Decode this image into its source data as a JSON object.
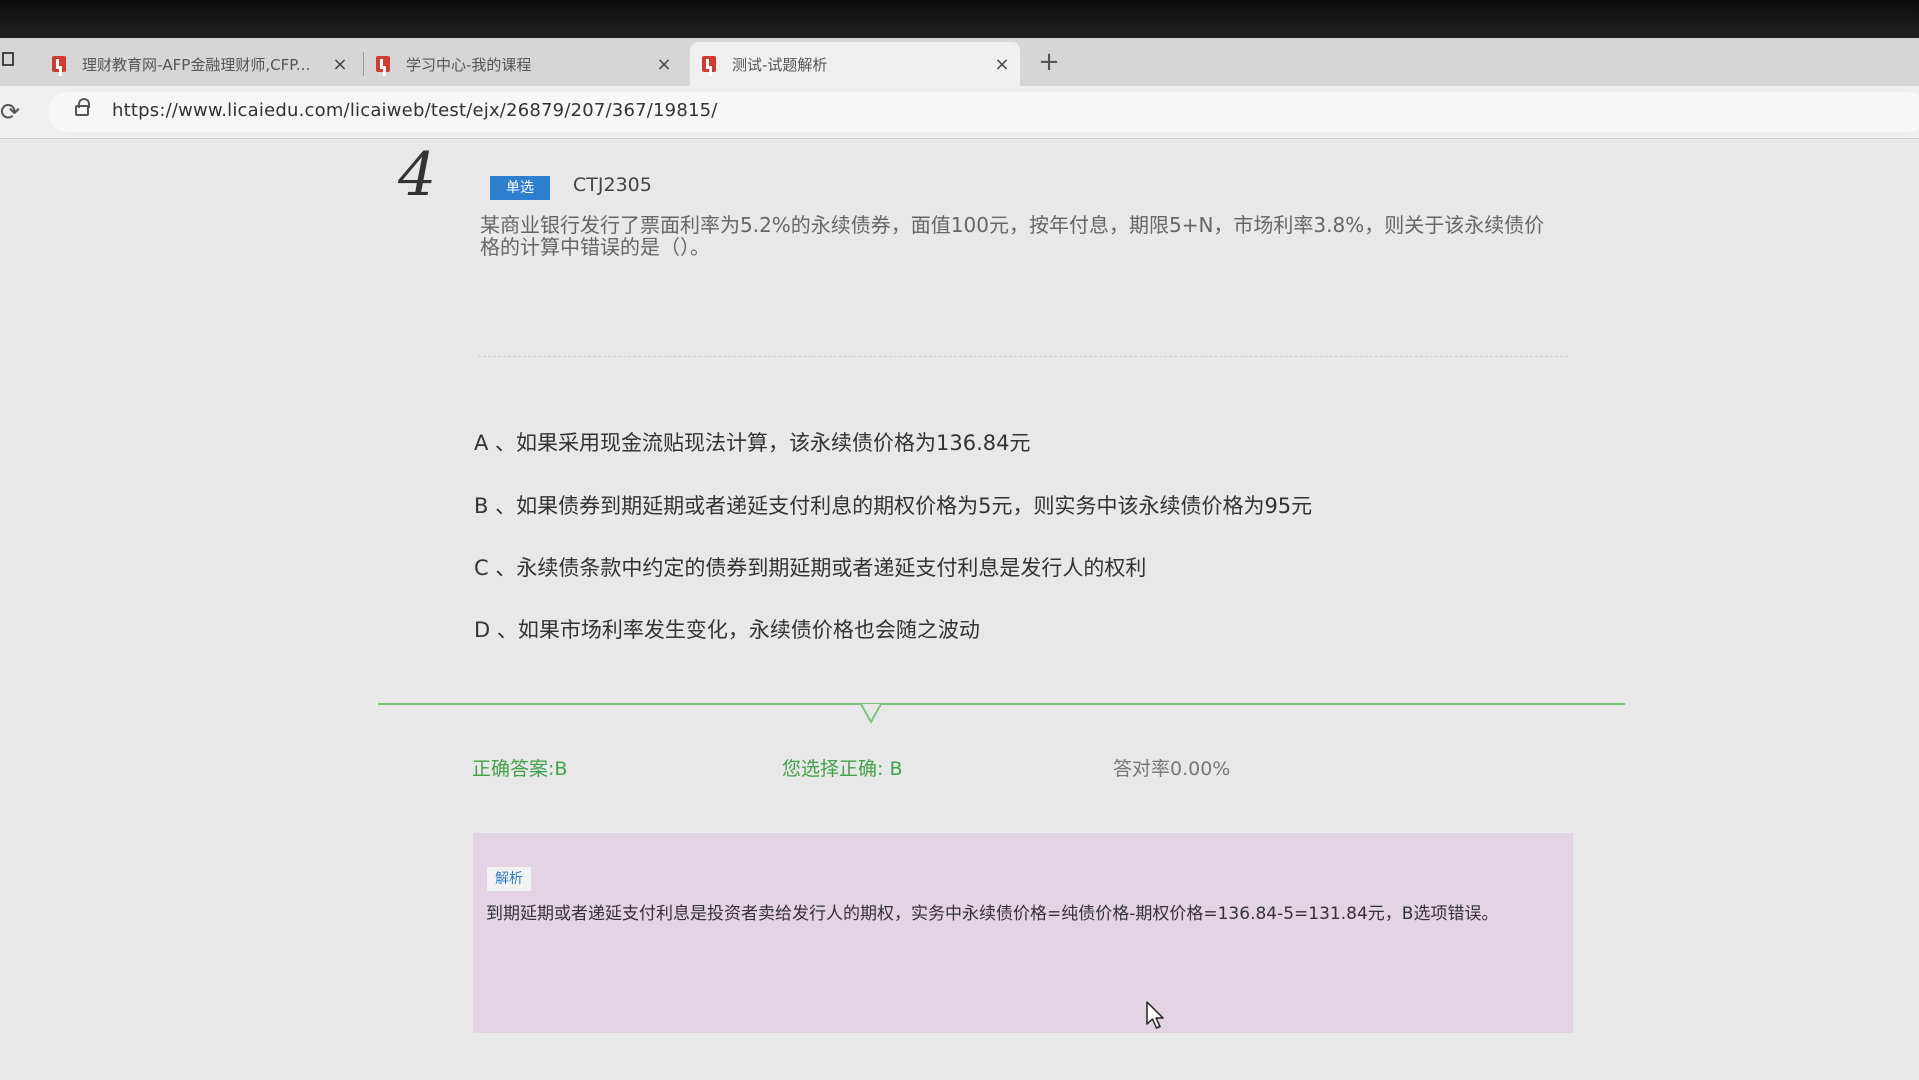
{
  "browser": {
    "tabs": [
      {
        "title": "理财教育网-AFP金融理财师,CFP...",
        "close": "×"
      },
      {
        "title": "学习中心-我的课程",
        "close": "×"
      },
      {
        "title": "测试-试题解析",
        "close": "×"
      }
    ],
    "new_tab": "+",
    "reload": "⟳",
    "url": "https://www.licaiedu.com/licaiweb/test/ejx/26879/207/367/19815/"
  },
  "question": {
    "number": "4",
    "type_badge": "单选",
    "code": "CTJ2305",
    "text": "某商业银行发行了票面利率为5.2%的永续债券，面值100元，按年付息，期限5+N，市场利率3.8%，则关于该永续债价格的计算中错误的是（）。",
    "options": [
      "A 、如果采用现金流贴现法计算，该永续债价格为136.84元",
      "B 、如果债券到期延期或者递延支付利息的期权价格为5元，则实务中该永续债价格为95元",
      "C 、永续债条款中约定的债券到期延期或者递延支付利息是发行人的权利",
      "D 、如果市场利率发生变化，永续债价格也会随之波动"
    ]
  },
  "result": {
    "correct_answer": "正确答案:B",
    "your_choice": "您选择正确: B",
    "accuracy": "答对率0.00%"
  },
  "explanation": {
    "tag": "解析",
    "text": "到期延期或者递延支付利息是投资者卖给发行人的期权，实务中永续债价格=纯债价格-期权价格=136.84-5=131.84元，B选项错误。"
  },
  "colors": {
    "badge": "#2e7fd0",
    "correct_green": "#3fa24a",
    "divider_green": "#7bc47f",
    "explain_bg": "#e3d3e3"
  }
}
